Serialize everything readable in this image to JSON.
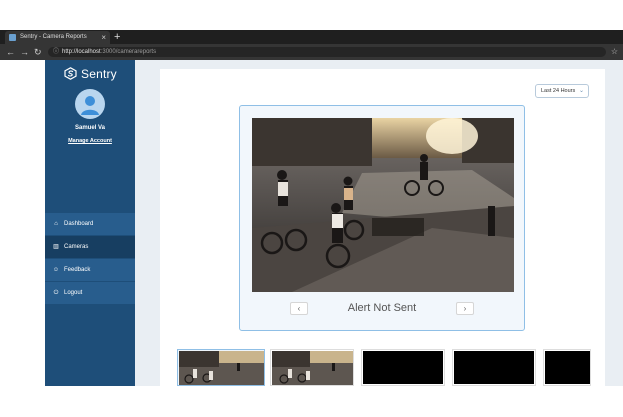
{
  "browser": {
    "tab_title": "Sentry - Camera Reports",
    "tab_close": "×",
    "new_tab": "+",
    "url_host": "http://localhost",
    "url_rest": ":3000/camerareports",
    "back": "←",
    "forward": "→",
    "reload": "↻",
    "info": "ⓘ",
    "bookmark": "☆"
  },
  "app": {
    "brand": "Sentry",
    "user": {
      "name": "Samuel Va",
      "manage_label": "Manage Account"
    },
    "nav": [
      {
        "label": "Dashboard",
        "icon": "⌂",
        "icon_name": "home-icon",
        "active": false
      },
      {
        "label": "Cameras",
        "icon": "▥",
        "icon_name": "bar-chart-icon",
        "active": true
      },
      {
        "label": "Feedback",
        "icon": "☺",
        "icon_name": "smiley-icon",
        "active": false
      },
      {
        "label": "Logout",
        "icon": "⏻",
        "icon_name": "power-icon",
        "active": false
      }
    ],
    "range_select": {
      "value": "Last 24 Hours",
      "chevron": "⌄"
    },
    "viewer": {
      "status": "Alert Not Sent",
      "prev": "‹",
      "next": "›"
    }
  },
  "colors": {
    "sidebar": "#1e4e79",
    "sidebar_item": "#285d8d",
    "sidebar_active": "#173e61",
    "accent_border": "#8fbfe6"
  }
}
